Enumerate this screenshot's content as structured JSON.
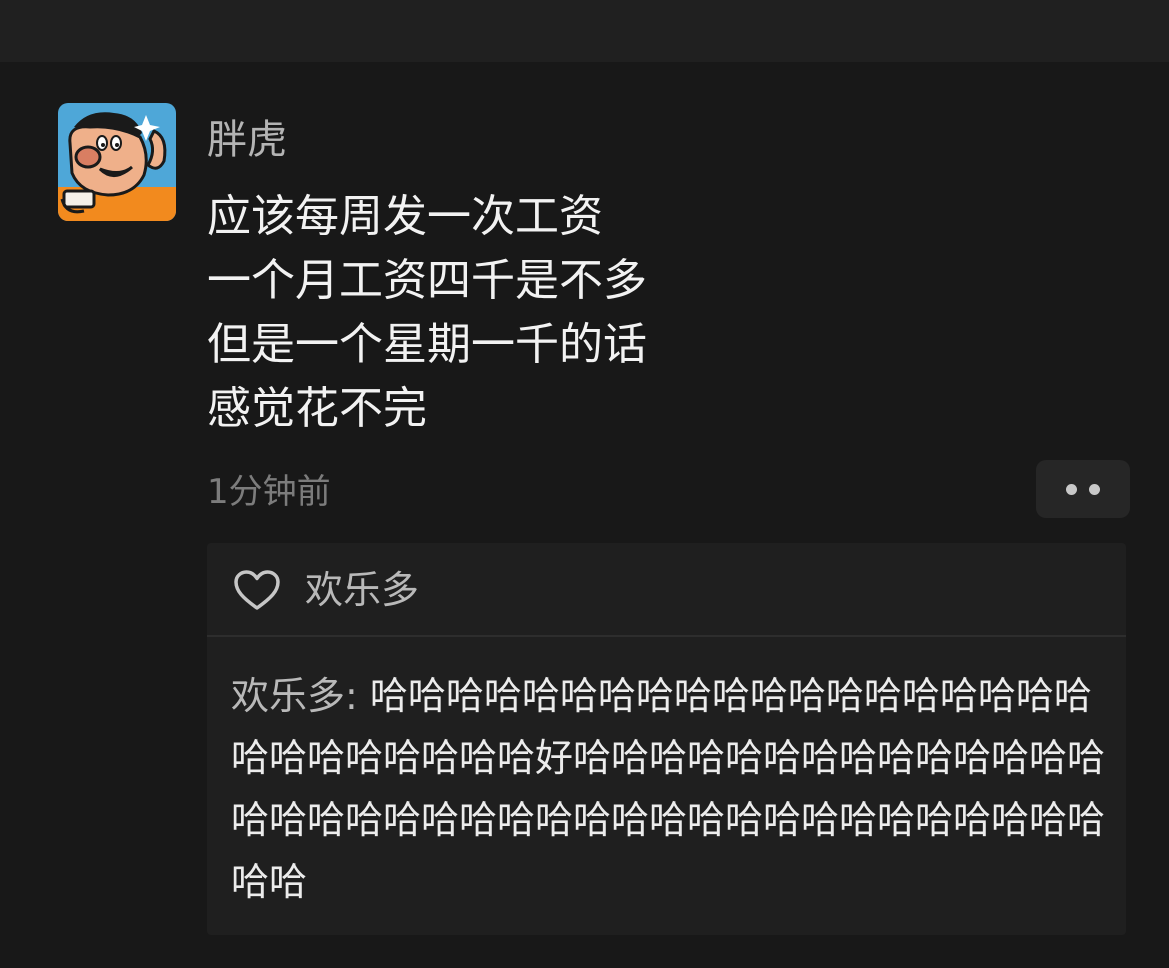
{
  "post": {
    "author": "胖虎",
    "avatar_icon": "gian-cartoon-avatar-icon",
    "lines": [
      "应该每周发一次工资",
      "一个月工资四千是不多",
      "但是一个星期一千的话",
      "感觉花不完"
    ],
    "timestamp": "1分钟前",
    "more_icon": "more-dots-icon"
  },
  "likes": {
    "icon": "heart-icon",
    "users": "欢乐多"
  },
  "comments": [
    {
      "author": "欢乐多",
      "separator": ": ",
      "text": "哈哈哈哈哈哈哈哈哈哈哈哈哈哈哈哈哈哈哈哈哈哈哈哈哈哈哈好哈哈哈哈哈哈哈哈哈哈哈哈哈哈哈哈哈哈哈哈哈哈哈哈哈哈哈哈哈哈哈哈哈哈哈哈哈哈哈"
    }
  ],
  "colors": {
    "background": "#181818",
    "panel": "#1f1f1f",
    "name": "#b4b4b4",
    "text": "#f2f2f2",
    "meta": "#7c7c7c"
  }
}
